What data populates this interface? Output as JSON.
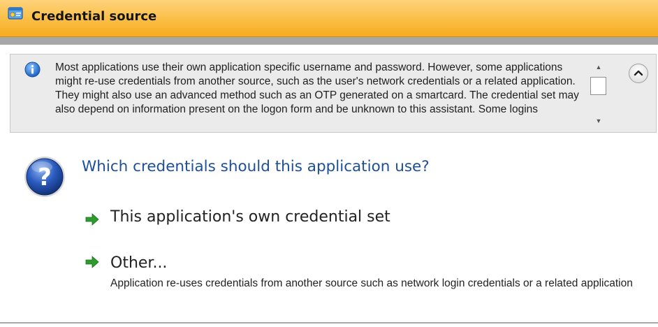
{
  "dialog": {
    "title": "Credential source"
  },
  "info": {
    "text": "Most applications use their own application specific username and password. However, some applications might re-use credentials from another source, such as the user's network credentials or a related application. They might also use an advanced method such as an OTP generated on a smartcard. The credential set may also depend on information present on the logon form and be unknown to this assistant. Some logins"
  },
  "question": {
    "text": "Which credentials should this application use?"
  },
  "options": [
    {
      "label": "This application's own credential set",
      "description": ""
    },
    {
      "label": "Other...",
      "description": "Application re-uses credentials from another source such as network login credentials or a related application"
    }
  ],
  "colors": {
    "title_bar": "#f7ab1f",
    "question_text": "#1d4f9a",
    "arrow": "#2e9b2e"
  }
}
